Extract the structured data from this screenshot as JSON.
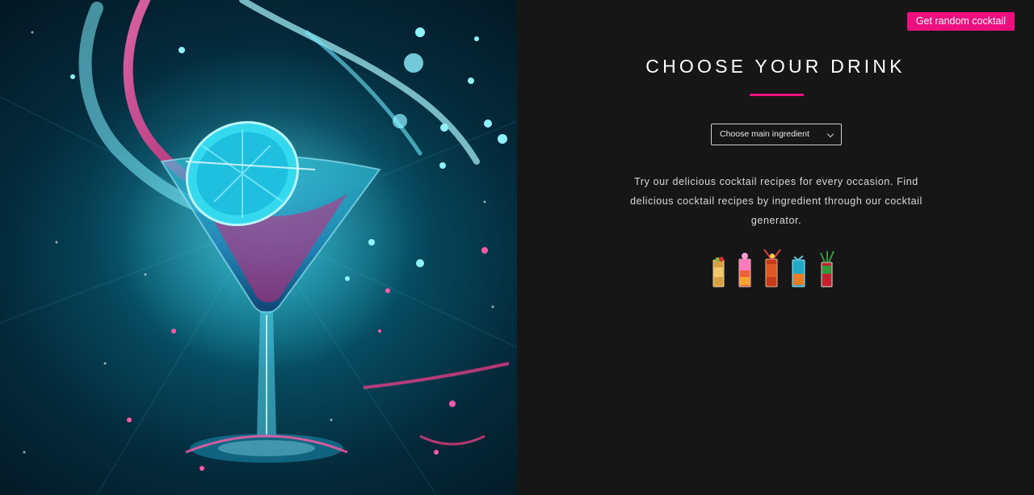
{
  "header": {
    "random_button_label": "Get random cocktail"
  },
  "main": {
    "title": "CHOOSE YOUR DRINK",
    "ingredient_select": {
      "selected_label": "Choose main ingredient"
    },
    "description": "Try our delicious cocktail recipes for every occasion. Find delicious cocktail recipes by ingredient through our cocktail generator."
  },
  "colors": {
    "accent": "#ee0f7f",
    "panel_bg": "#161616",
    "hero_cyan": "#1fd1e8",
    "hero_magenta": "#ff3d8f"
  },
  "icons": [
    "cocktail-glass-icon",
    "chevron-down-icon"
  ]
}
